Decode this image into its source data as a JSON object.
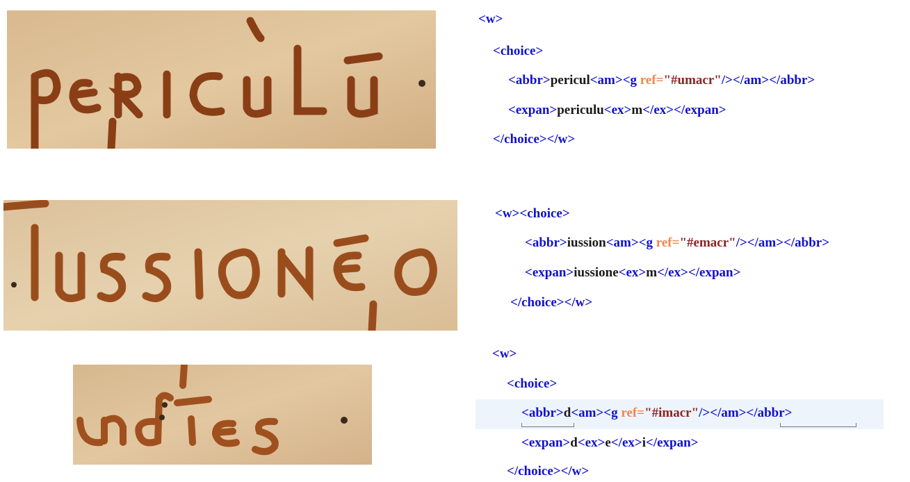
{
  "images": [
    {
      "name": "manuscript-periculum",
      "word": "pericuLū"
    },
    {
      "name": "manuscript-iussionem",
      "word": "Iussionē"
    },
    {
      "name": "manuscript-dies",
      "word": "dīes"
    }
  ],
  "snippets": [
    {
      "lines": [
        [
          {
            "t": "tag",
            "v": "<w>"
          }
        ],
        [
          {
            "t": "tag",
            "v": "<choice>"
          }
        ],
        [
          {
            "t": "tag",
            "v": "<abbr>"
          },
          {
            "t": "txt",
            "v": "pericul"
          },
          {
            "t": "tag",
            "v": "<am><g "
          },
          {
            "t": "attr",
            "v": "ref="
          },
          {
            "t": "val",
            "v": "\"#umacr\""
          },
          {
            "t": "tag",
            "v": "/></am></abbr>"
          }
        ],
        [
          {
            "t": "tag",
            "v": "<expan>"
          },
          {
            "t": "txt",
            "v": "periculu"
          },
          {
            "t": "tag",
            "v": "<ex>"
          },
          {
            "t": "txt",
            "v": "m"
          },
          {
            "t": "tag",
            "v": "</ex></expan>"
          }
        ],
        [
          {
            "t": "tag",
            "v": "</choice></w>"
          }
        ]
      ]
    },
    {
      "lines": [
        [
          {
            "t": "tag",
            "v": "<w><choice>"
          }
        ],
        [
          {
            "t": "tag",
            "v": "<abbr>"
          },
          {
            "t": "txt",
            "v": "iussion"
          },
          {
            "t": "tag",
            "v": "<am><g "
          },
          {
            "t": "attr",
            "v": "ref="
          },
          {
            "t": "val",
            "v": "\"#emacr\""
          },
          {
            "t": "tag",
            "v": "/></am></abbr>"
          }
        ],
        [
          {
            "t": "tag",
            "v": "<expan>"
          },
          {
            "t": "txt",
            "v": "iussione"
          },
          {
            "t": "tag",
            "v": "<ex>"
          },
          {
            "t": "txt",
            "v": "m"
          },
          {
            "t": "tag",
            "v": "</ex></expan>"
          }
        ],
        [
          {
            "t": "tag",
            "v": "</choice></w>"
          }
        ]
      ]
    },
    {
      "lines": [
        [
          {
            "t": "tag",
            "v": "<w>"
          }
        ],
        [
          {
            "t": "tag",
            "v": "<choice>"
          }
        ],
        [
          {
            "t": "tag",
            "v": "<abbr>"
          },
          {
            "t": "txt",
            "v": "d"
          },
          {
            "t": "tag",
            "v": "<am><g "
          },
          {
            "t": "attr",
            "v": "ref="
          },
          {
            "t": "val",
            "v": "\"#imacr\""
          },
          {
            "t": "tag",
            "v": "/></am></abbr>"
          }
        ],
        [
          {
            "t": "tag",
            "v": "<expan>"
          },
          {
            "t": "txt",
            "v": "d"
          },
          {
            "t": "tag",
            "v": "<ex>"
          },
          {
            "t": "txt",
            "v": "e"
          },
          {
            "t": "tag",
            "v": "</ex>"
          },
          {
            "t": "txt",
            "v": "i"
          },
          {
            "t": "tag",
            "v": "</expan>"
          }
        ],
        [
          {
            "t": "tag",
            "v": "</choice></w>"
          }
        ]
      ]
    }
  ],
  "colors": {
    "tag": "#1111cc",
    "attr": "#f0874e",
    "value": "#8a2424",
    "text": "#1a1a1a",
    "highlight": "#eef4fb"
  }
}
